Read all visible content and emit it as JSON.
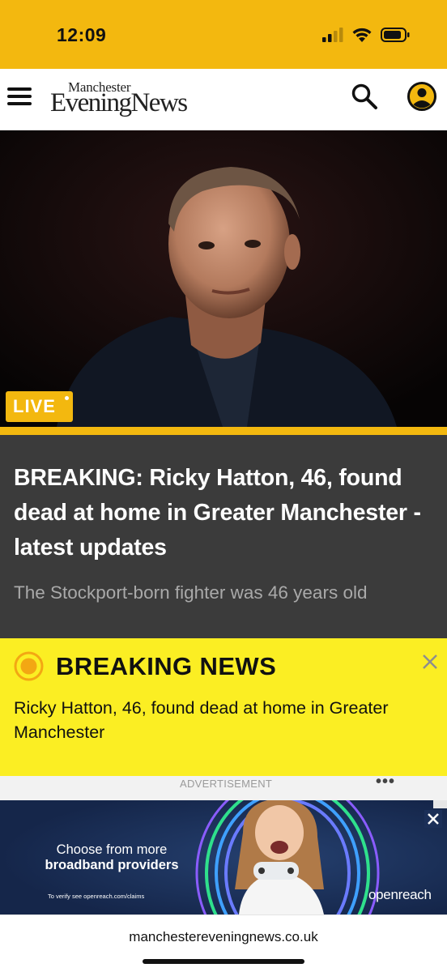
{
  "status_bar": {
    "time": "12:09",
    "icons": [
      "signal-icon",
      "wifi-icon",
      "battery-icon"
    ],
    "background": "#f3b80f"
  },
  "header": {
    "logo_top": "Manchester",
    "logo_main": "EveningNews",
    "menu_icon": "hamburger-menu-icon",
    "search_icon": "search-icon",
    "account_icon": "account-icon"
  },
  "hero": {
    "image": "portrait-photo",
    "badge": "LIVE"
  },
  "story": {
    "headline": "BREAKING: Ricky Hatton, 46, found dead at home in Greater Manchester - latest updates",
    "subhead": "The Stockport-born fighter was 46 years old"
  },
  "breaking_news": {
    "title": "BREAKING NEWS",
    "text": "Ricky Hatton, 46, found dead at home in Greater Manchester",
    "background": "#fbee23",
    "accent": "#f3a713"
  },
  "advertisement": {
    "label": "ADVERTISEMENT",
    "menu": "•••",
    "line1": "Choose from more",
    "line2": "broadband providers",
    "small_print": "To verify see openreach.com/claims",
    "brand": "openreach"
  },
  "browser": {
    "url": "manchestereveningnews.co.uk"
  }
}
